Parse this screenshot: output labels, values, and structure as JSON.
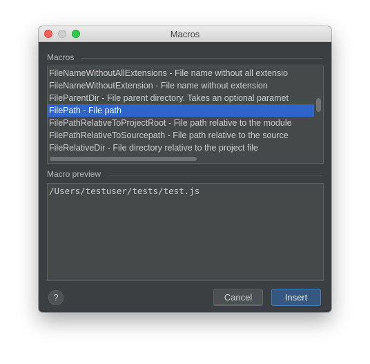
{
  "window": {
    "title": "Macros"
  },
  "macros": {
    "section_label": "Macros",
    "items": [
      {
        "label": "FileNameWithoutAllExtensions - File name without all extensio",
        "selected": false
      },
      {
        "label": "FileNameWithoutExtension - File name without extension",
        "selected": false
      },
      {
        "label": "FileParentDir - File parent directory. Takes an optional paramet",
        "selected": false
      },
      {
        "label": "FilePath - File path",
        "selected": true
      },
      {
        "label": "FilePathRelativeToProjectRoot - File path relative to the module",
        "selected": false
      },
      {
        "label": "FilePathRelativeToSourcepath - File path relative to the source",
        "selected": false
      },
      {
        "label": "FileRelativeDir - File directory relative to the project file",
        "selected": false
      }
    ]
  },
  "preview": {
    "section_label": "Macro preview",
    "value": "/Users/testuser/tests/test.js"
  },
  "buttons": {
    "help": "?",
    "cancel": "Cancel",
    "insert": "Insert"
  },
  "colors": {
    "background": "#3c3f41",
    "selection": "#2f65ca",
    "default_button": "#365880"
  }
}
